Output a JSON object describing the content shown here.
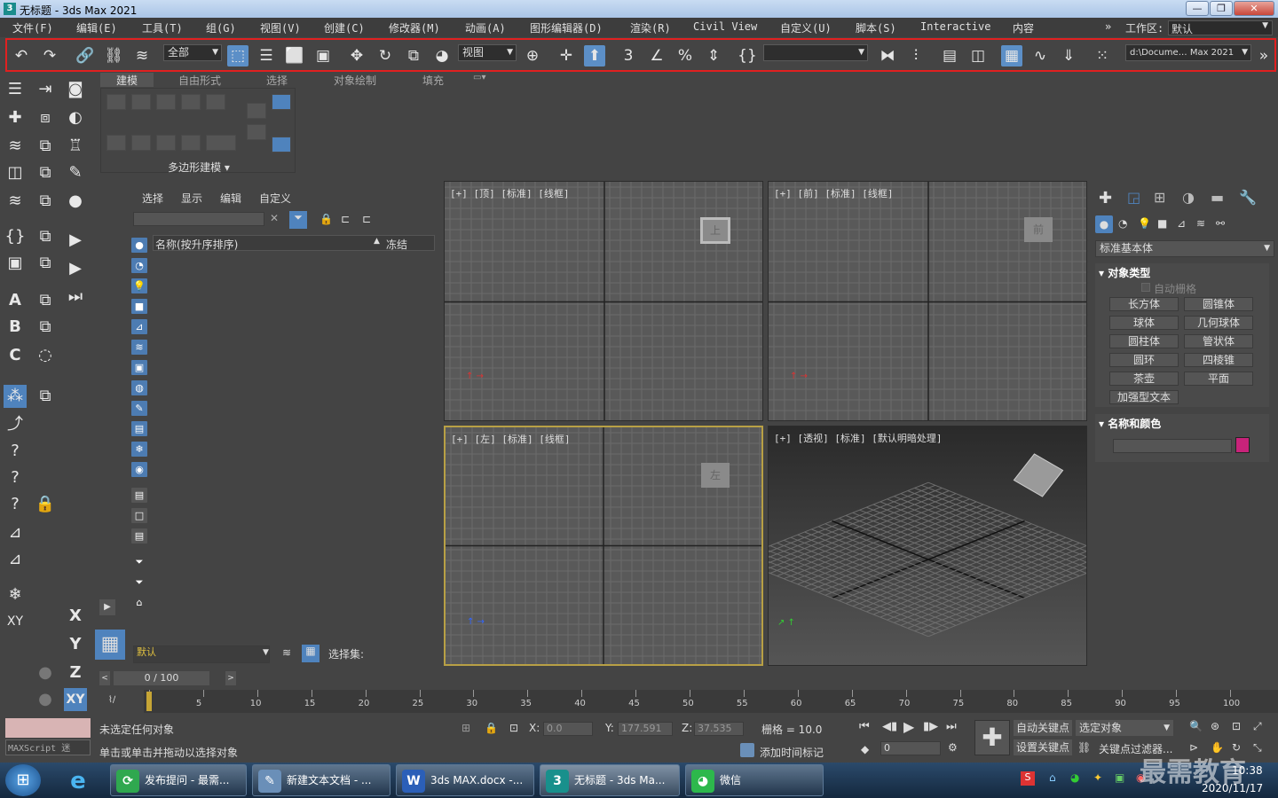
{
  "window": {
    "title": "无标题 - 3ds Max 2021",
    "app_icon": "3",
    "buttons": [
      "—",
      "❐",
      "✕"
    ]
  },
  "menu": {
    "items": [
      "文件(F)",
      "编辑(E)",
      "工具(T)",
      "组(G)",
      "视图(V)",
      "创建(C)",
      "修改器(M)",
      "动画(A)",
      "图形编辑器(D)",
      "渲染(R)",
      "Civil View",
      "自定义(U)",
      "脚本(S)",
      "Interactive",
      "内容"
    ],
    "overflow": "»",
    "workspace_label": "工作区:",
    "workspace_value": "默认"
  },
  "toolbar": {
    "selection_filter": "全部",
    "reference_coord": "视图",
    "named_selection": "",
    "project_path": "d:\\Docume… Max 2021"
  },
  "ribbon": {
    "tabs": [
      "建模",
      "自由形式",
      "选择",
      "对象绘制",
      "填充"
    ],
    "group_label": "多边形建模 ▾"
  },
  "scene_explorer": {
    "menu": [
      "选择",
      "显示",
      "编辑",
      "自定义"
    ],
    "col_name": "名称(按升序排序)",
    "col_frozen": "冻结",
    "layer": "默认",
    "selection_set_label": "选择集:"
  },
  "viewports": {
    "top": "[+] [顶] [标准] [线框]",
    "front": "[+] [前] [标准] [线框]",
    "left": "[+] [左] [标准] [线框]",
    "perspective": "[+] [透视] [标准] [默认明暗处理]",
    "cube_top": "上",
    "cube_front": "前",
    "cube_left": "左"
  },
  "command_panel": {
    "category": "标准基本体",
    "rollout_object_type": "对象类型",
    "autogrid": "自动栅格",
    "objects": [
      "长方体",
      "圆锥体",
      "球体",
      "几何球体",
      "圆柱体",
      "管状体",
      "圆环",
      "四棱锥",
      "茶壶",
      "平面",
      "加强型文本"
    ],
    "rollout_name_color": "名称和颜色",
    "object_color": "#c8237a"
  },
  "timeline": {
    "frame_display": "0 / 100",
    "ticks": [
      "0",
      "5",
      "10",
      "15",
      "20",
      "25",
      "30",
      "35",
      "40",
      "45",
      "50",
      "55",
      "60",
      "65",
      "70",
      "75",
      "80",
      "85",
      "90",
      "95",
      "100"
    ]
  },
  "status": {
    "maxscript": "MAXScript 迷",
    "line1": "未选定任何对象",
    "line2": "单击或单击并拖动以选择对象",
    "x_label": "X:",
    "x_value": "0.0",
    "y_label": "Y:",
    "y_value": "177.591",
    "z_label": "Z:",
    "z_value": "37.535",
    "grid": "栅格 = 10.0",
    "add_time_tag": "添加时间标记",
    "auto_key": "自动关键点",
    "set_key": "设置关键点",
    "selected_object": "选定对象",
    "key_filter": "关键点过滤器...",
    "frame_value": "0"
  },
  "taskbar": {
    "items": [
      "发布提问 - 最需...",
      "新建文本文档 - ...",
      "3ds MAX.docx -...",
      "无标题 - 3ds Ma...",
      "微信"
    ],
    "time": "10:38",
    "date": "2020/11/17",
    "watermark": "最需教育"
  }
}
